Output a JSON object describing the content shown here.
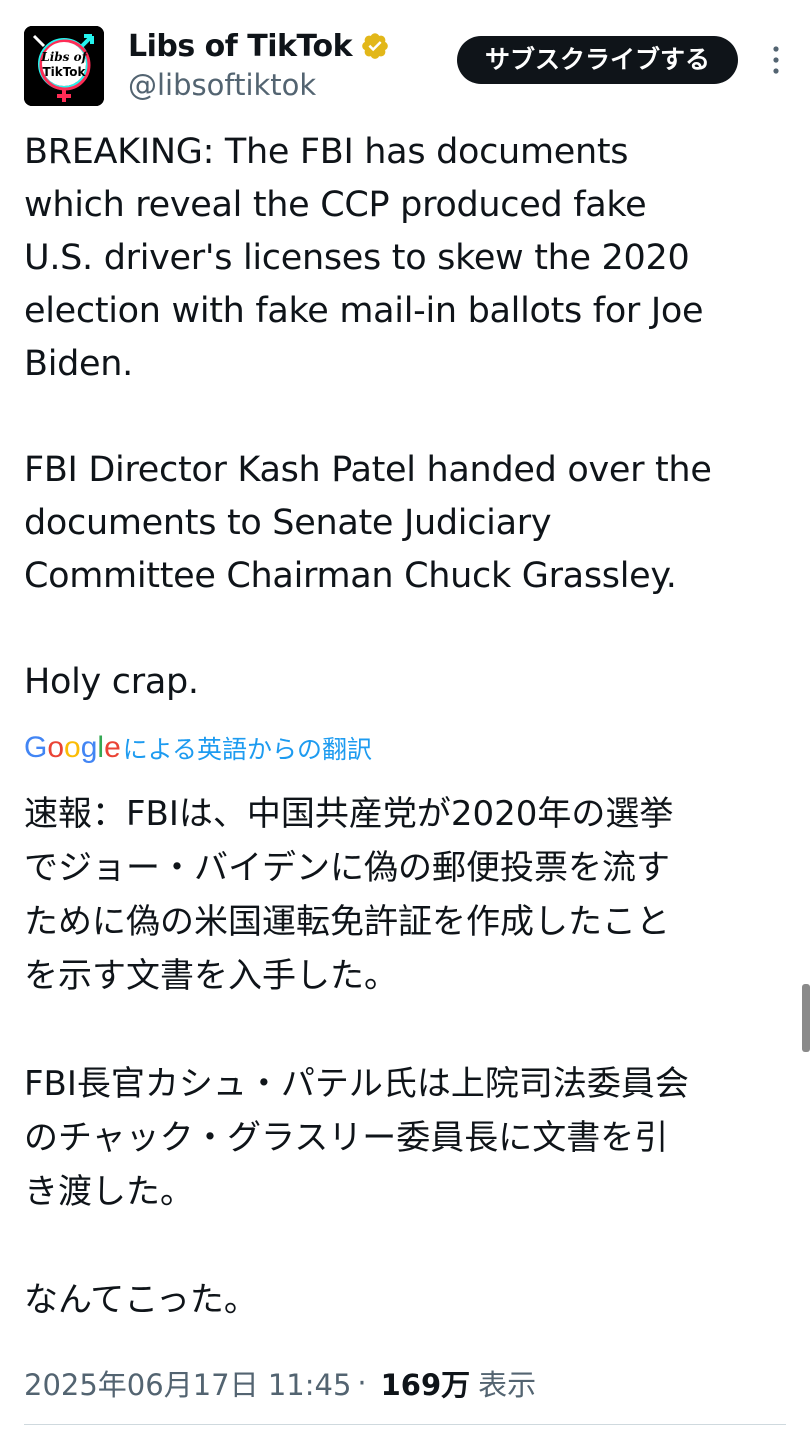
{
  "author": {
    "display_name": "Libs of TikTok",
    "handle": "@libsoftiktok",
    "avatar_text_line1": "Libs of",
    "avatar_text_line2": "TikTok"
  },
  "header": {
    "subscribe_label": "サブスクライブする"
  },
  "tweet": {
    "text": "BREAKING: The FBI has documents\nwhich reveal the CCP produced fake\nU.S. driver's licenses to skew the 2020\nelection with fake mail-in ballots for Joe\nBiden.\n\nFBI Director Kash Patel handed over the\ndocuments to Senate Judiciary\nCommittee Chairman Chuck Grassley.\n\nHoly crap.",
    "translation_label": "による英語からの翻訳",
    "translation_provider": "Google",
    "translated_text": "速報：FBIは、中国共産党が2020年の選挙\nでジョー・バイデンに偽の郵便投票を流す\nために偽の米国運転免許証を作成したこと\nを示す文書を入手した。\n\nFBI長官カシュ・パテル氏は上院司法委員会\nのチャック・グラスリー委員長に文書を引\nき渡した。\n\nなんてこった。"
  },
  "meta": {
    "timestamp": "2025年06月17日 11:45",
    "separator": "·",
    "views_count": "169万",
    "views_label": "表示"
  },
  "colors": {
    "text": "#0f1419",
    "secondary": "#536471",
    "link": "#1d9bf0",
    "verified_gold": "#e2b719"
  }
}
